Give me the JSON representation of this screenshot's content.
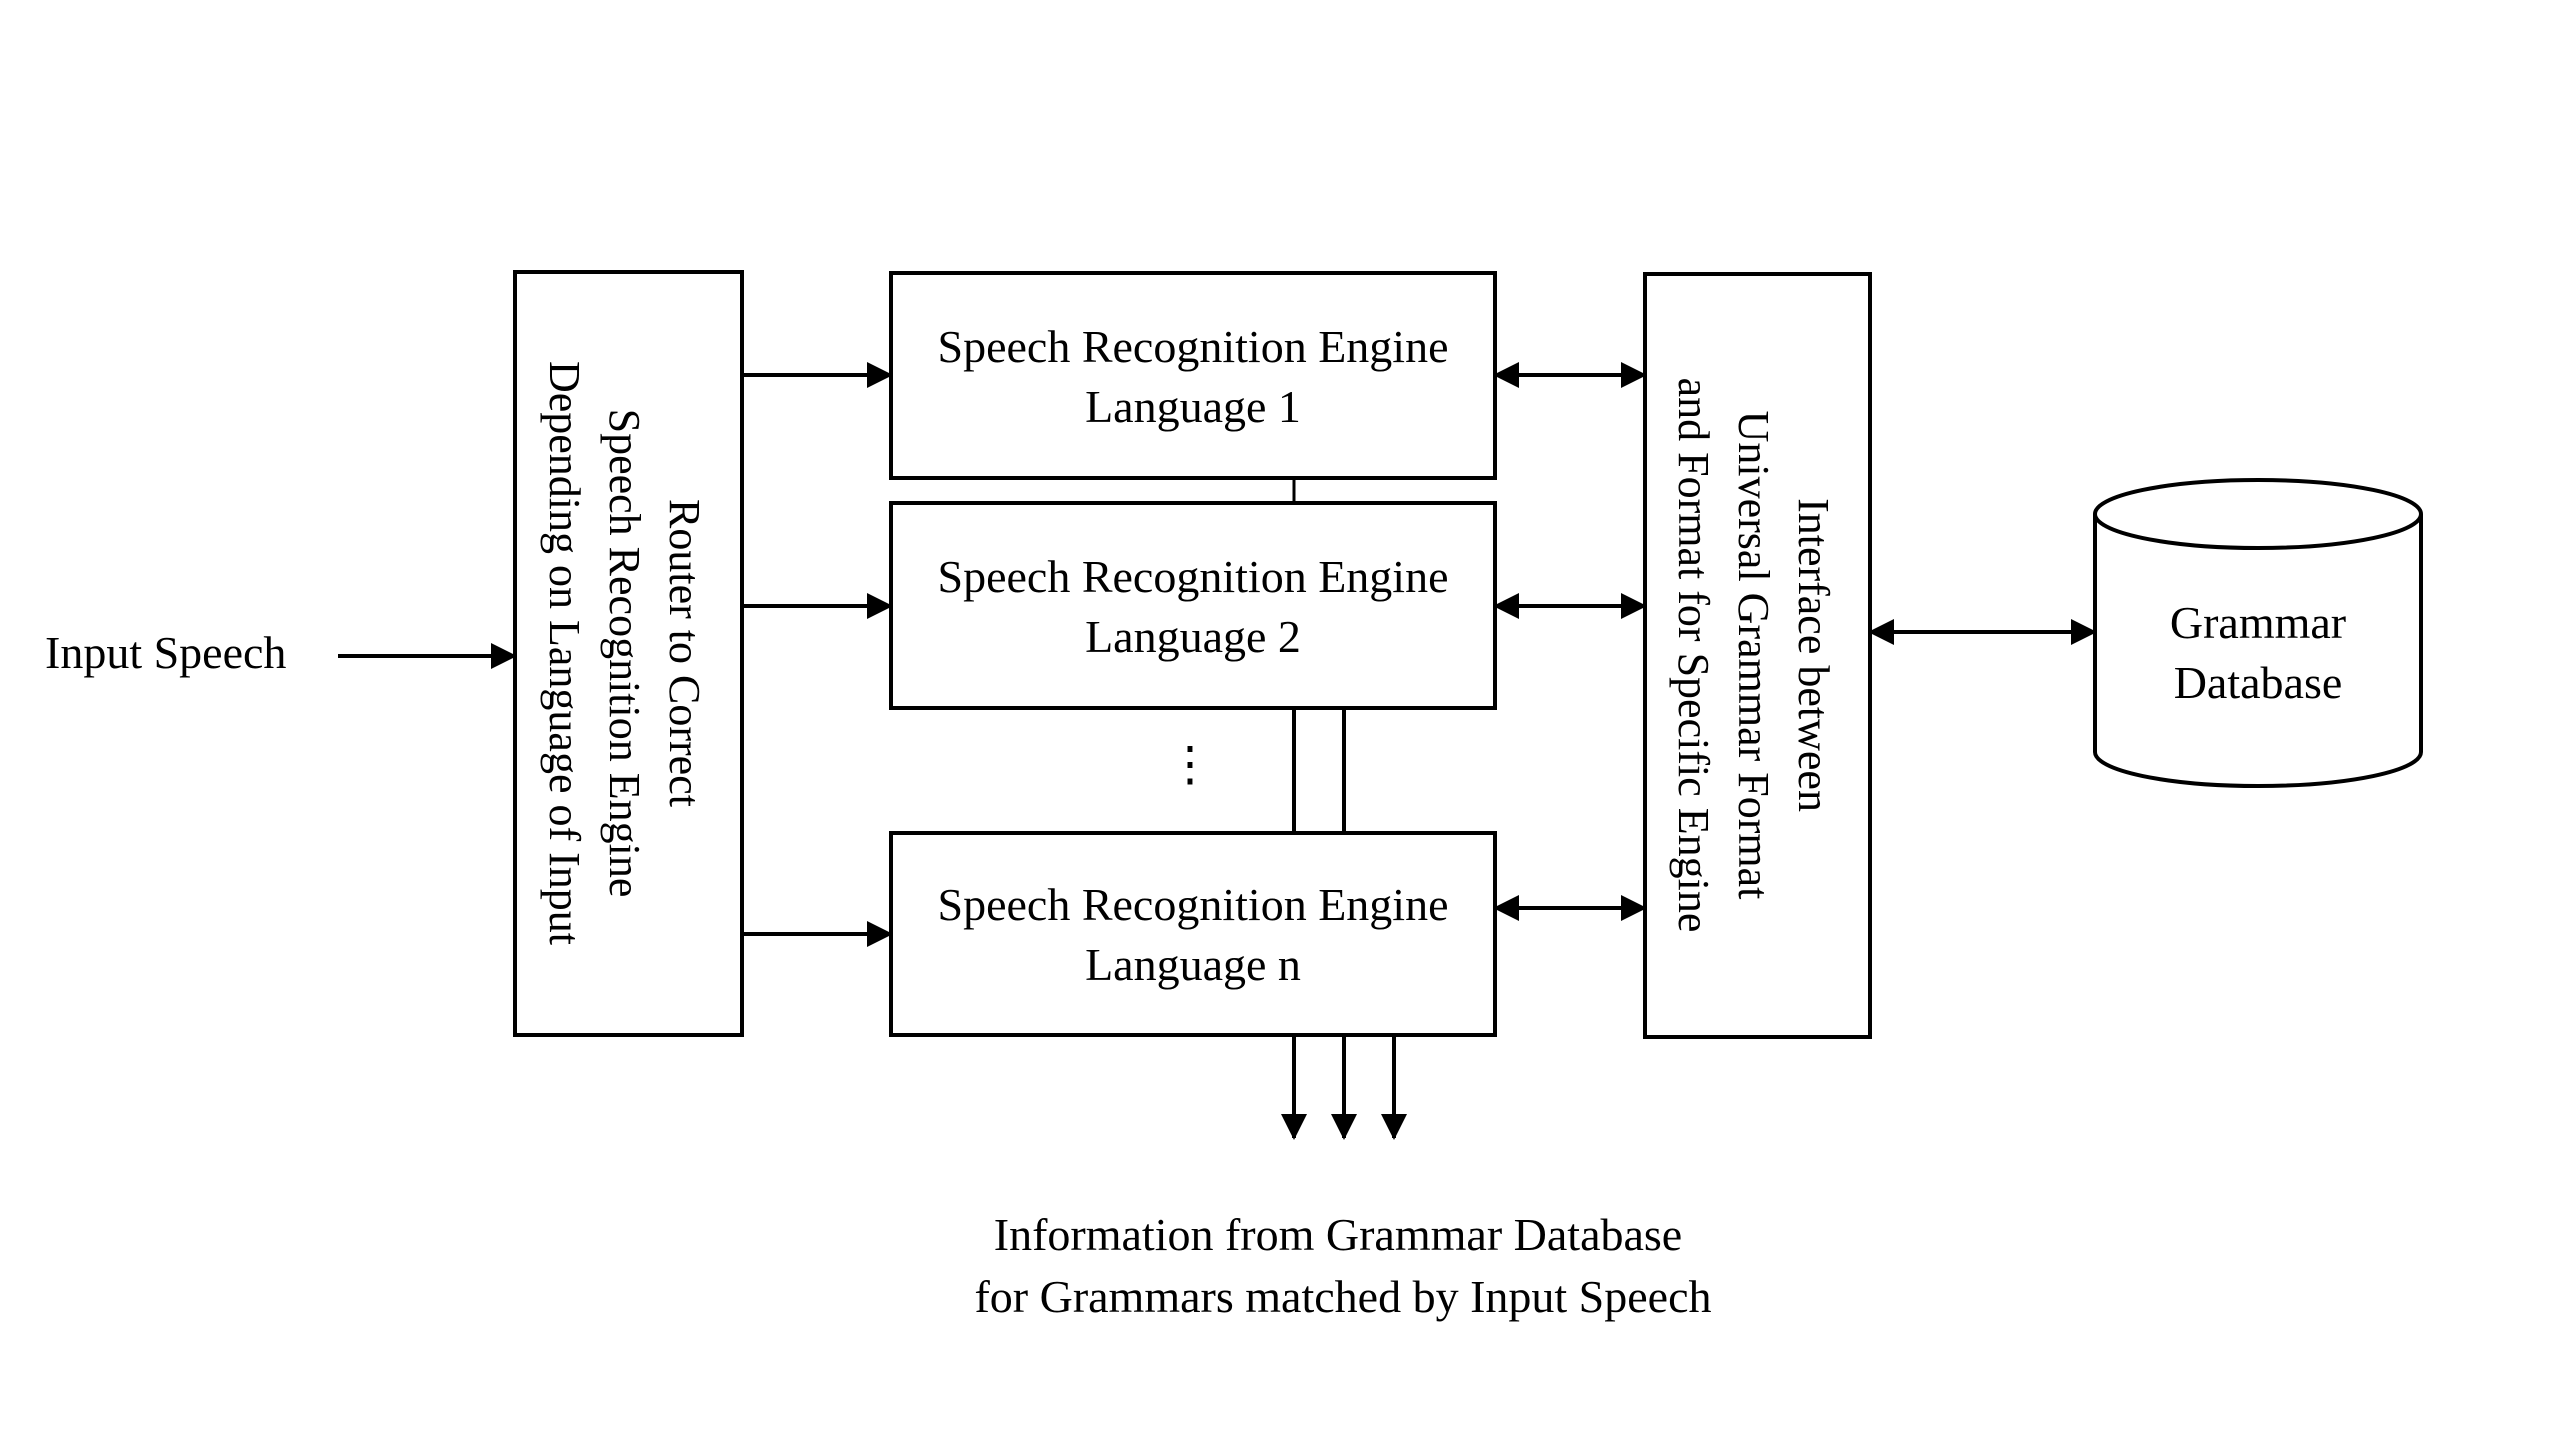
{
  "input_label": "Input Speech",
  "router": {
    "lines": [
      "Router to Correct",
      "Speech Recognition Engine",
      "Depending on Language of Input"
    ]
  },
  "engines": [
    {
      "line1": "Speech Recognition Engine",
      "line2": "Language 1"
    },
    {
      "line1": "Speech Recognition Engine",
      "line2": "Language 2"
    },
    {
      "line1": "Speech Recognition Engine",
      "line2": "Language n"
    }
  ],
  "ellipsis": "⋮",
  "interface": {
    "lines": [
      "Interface between",
      "Universal Grammar Format",
      "and Format for Specific Engine"
    ]
  },
  "database": {
    "lines": [
      "Grammar",
      "Database"
    ]
  },
  "output": {
    "lines": [
      "Information from Grammar Database",
      "for Grammars matched by Input Speech"
    ]
  }
}
